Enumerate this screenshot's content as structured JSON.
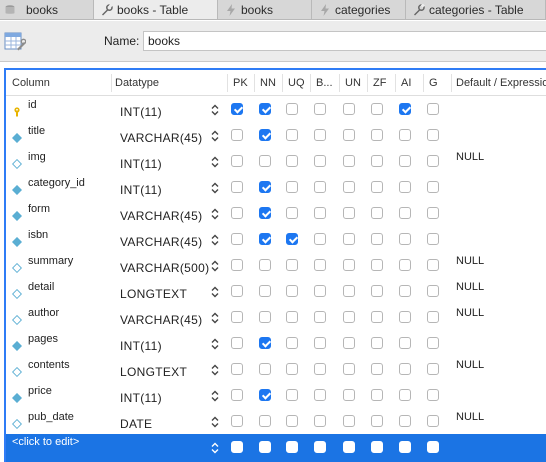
{
  "tabs": [
    {
      "label": "books",
      "icon": "database-icon",
      "active": false
    },
    {
      "label": "books - Table",
      "icon": "wrench-icon",
      "active": true
    },
    {
      "label": "books",
      "icon": "lightning-icon",
      "active": false
    },
    {
      "label": "categories",
      "icon": "lightning-icon",
      "active": false
    },
    {
      "label": "categories - Table",
      "icon": "wrench-icon",
      "active": false
    }
  ],
  "header": {
    "name_label": "Name:",
    "name_value": "books"
  },
  "grid": {
    "columns": [
      "Column",
      "Datatype",
      "PK",
      "NN",
      "UQ",
      "B...",
      "UN",
      "ZF",
      "AI",
      "G",
      "Default / Expression"
    ],
    "rows": [
      {
        "name": "id",
        "type": "INT(11)",
        "key": "primary",
        "flags": [
          1,
          1,
          0,
          0,
          0,
          0,
          1,
          0
        ],
        "default": ""
      },
      {
        "name": "title",
        "type": "VARCHAR(45)",
        "key": "notnull",
        "flags": [
          0,
          1,
          0,
          0,
          0,
          0,
          0,
          0
        ],
        "default": ""
      },
      {
        "name": "img",
        "type": "INT(11)",
        "key": "plain",
        "flags": [
          0,
          0,
          0,
          0,
          0,
          0,
          0,
          0
        ],
        "default": "NULL"
      },
      {
        "name": "category_id",
        "type": "INT(11)",
        "key": "notnull",
        "flags": [
          0,
          1,
          0,
          0,
          0,
          0,
          0,
          0
        ],
        "default": ""
      },
      {
        "name": "form",
        "type": "VARCHAR(45)",
        "key": "notnull",
        "flags": [
          0,
          1,
          0,
          0,
          0,
          0,
          0,
          0
        ],
        "default": ""
      },
      {
        "name": "isbn",
        "type": "VARCHAR(45)",
        "key": "notnull",
        "flags": [
          0,
          1,
          1,
          0,
          0,
          0,
          0,
          0
        ],
        "default": ""
      },
      {
        "name": "summary",
        "type": "VARCHAR(500)",
        "key": "plain",
        "flags": [
          0,
          0,
          0,
          0,
          0,
          0,
          0,
          0
        ],
        "default": "NULL"
      },
      {
        "name": "detail",
        "type": "LONGTEXT",
        "key": "plain",
        "flags": [
          0,
          0,
          0,
          0,
          0,
          0,
          0,
          0
        ],
        "default": "NULL"
      },
      {
        "name": "author",
        "type": "VARCHAR(45)",
        "key": "plain",
        "flags": [
          0,
          0,
          0,
          0,
          0,
          0,
          0,
          0
        ],
        "default": "NULL"
      },
      {
        "name": "pages",
        "type": "INT(11)",
        "key": "notnull",
        "flags": [
          0,
          1,
          0,
          0,
          0,
          0,
          0,
          0
        ],
        "default": ""
      },
      {
        "name": "contents",
        "type": "LONGTEXT",
        "key": "plain",
        "flags": [
          0,
          0,
          0,
          0,
          0,
          0,
          0,
          0
        ],
        "default": "NULL"
      },
      {
        "name": "price",
        "type": "INT(11)",
        "key": "notnull",
        "flags": [
          0,
          1,
          0,
          0,
          0,
          0,
          0,
          0
        ],
        "default": ""
      },
      {
        "name": "pub_date",
        "type": "DATE",
        "key": "plain",
        "flags": [
          0,
          0,
          0,
          0,
          0,
          0,
          0,
          0
        ],
        "default": "NULL"
      }
    ],
    "new_row_label": "<click to edit>"
  },
  "colors": {
    "accent": "#1d77f1",
    "selection": "#1b74e4",
    "key_icon": "#e8b400",
    "field_icon": "#5aaed3"
  }
}
